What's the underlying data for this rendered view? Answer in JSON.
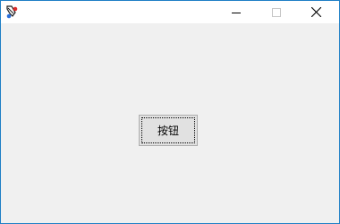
{
  "window": {
    "title": "",
    "border_color": "#1f7fc6",
    "icons": {
      "app": "app-icon",
      "minimize": "minimize-icon",
      "maximize": "maximize-icon",
      "close": "close-icon"
    }
  },
  "client": {
    "button_label": "按钮"
  }
}
